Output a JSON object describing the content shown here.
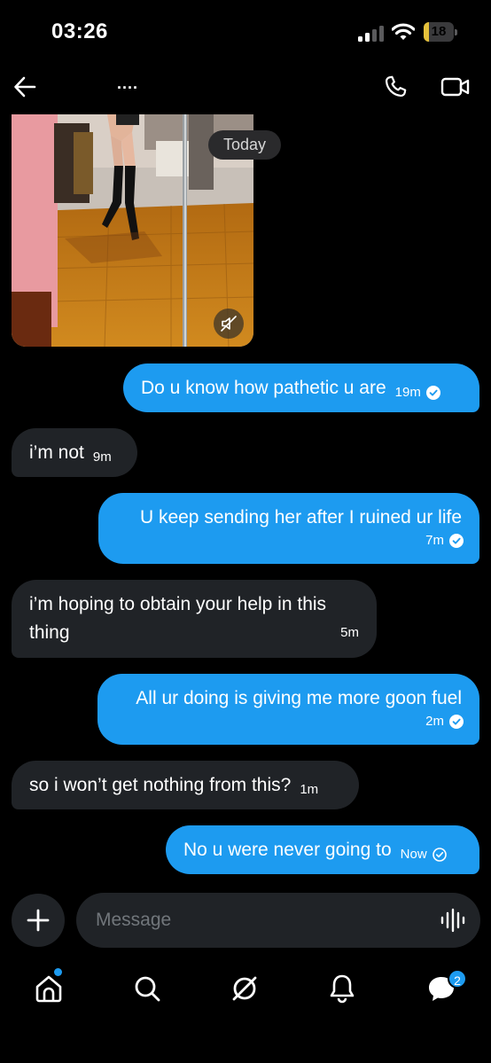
{
  "status_bar": {
    "time": "03:26",
    "battery": "18",
    "battery_level": 0.18,
    "battery_color": "#e5c13b"
  },
  "header": {
    "title": "....",
    "back_icon": "arrow-left-icon",
    "call_icon": "phone-icon",
    "video_icon": "video-camera-icon"
  },
  "media": {
    "kind": "video",
    "mute_icon": "speaker-muted-icon"
  },
  "date_separator": "Today",
  "messages": [
    {
      "direction": "out",
      "text": "Do u know how pathetic u are",
      "time": "19m",
      "status": "read"
    },
    {
      "direction": "in",
      "text": "i’m not",
      "time": "9m"
    },
    {
      "direction": "out",
      "text": "U keep sending her after I ruined ur life",
      "time": "7m",
      "status": "read"
    },
    {
      "direction": "in",
      "text": "i’m hoping to obtain your help in this thing",
      "time": "5m"
    },
    {
      "direction": "out",
      "text": "All ur doing is giving me more goon fuel",
      "time": "2m",
      "status": "read"
    },
    {
      "direction": "in",
      "text": "so i won’t get nothing from this?",
      "time": "1m"
    },
    {
      "direction": "out",
      "text": "No u were never going to",
      "time": "Now",
      "status": "sent"
    }
  ],
  "composer": {
    "placeholder": "Message",
    "add_icon": "plus-icon",
    "voice_icon": "voice-waveform-icon"
  },
  "tab_bar": {
    "tabs": [
      {
        "icon": "home-icon",
        "has_dot": true
      },
      {
        "icon": "search-icon"
      },
      {
        "icon": "grok-icon"
      },
      {
        "icon": "bell-icon"
      },
      {
        "icon": "messages-icon",
        "badge": "2"
      }
    ]
  },
  "colors": {
    "background": "#000000",
    "outgoing_bubble": "#1d9bf0",
    "incoming_bubble": "#202327",
    "accent": "#1d9bf0"
  }
}
